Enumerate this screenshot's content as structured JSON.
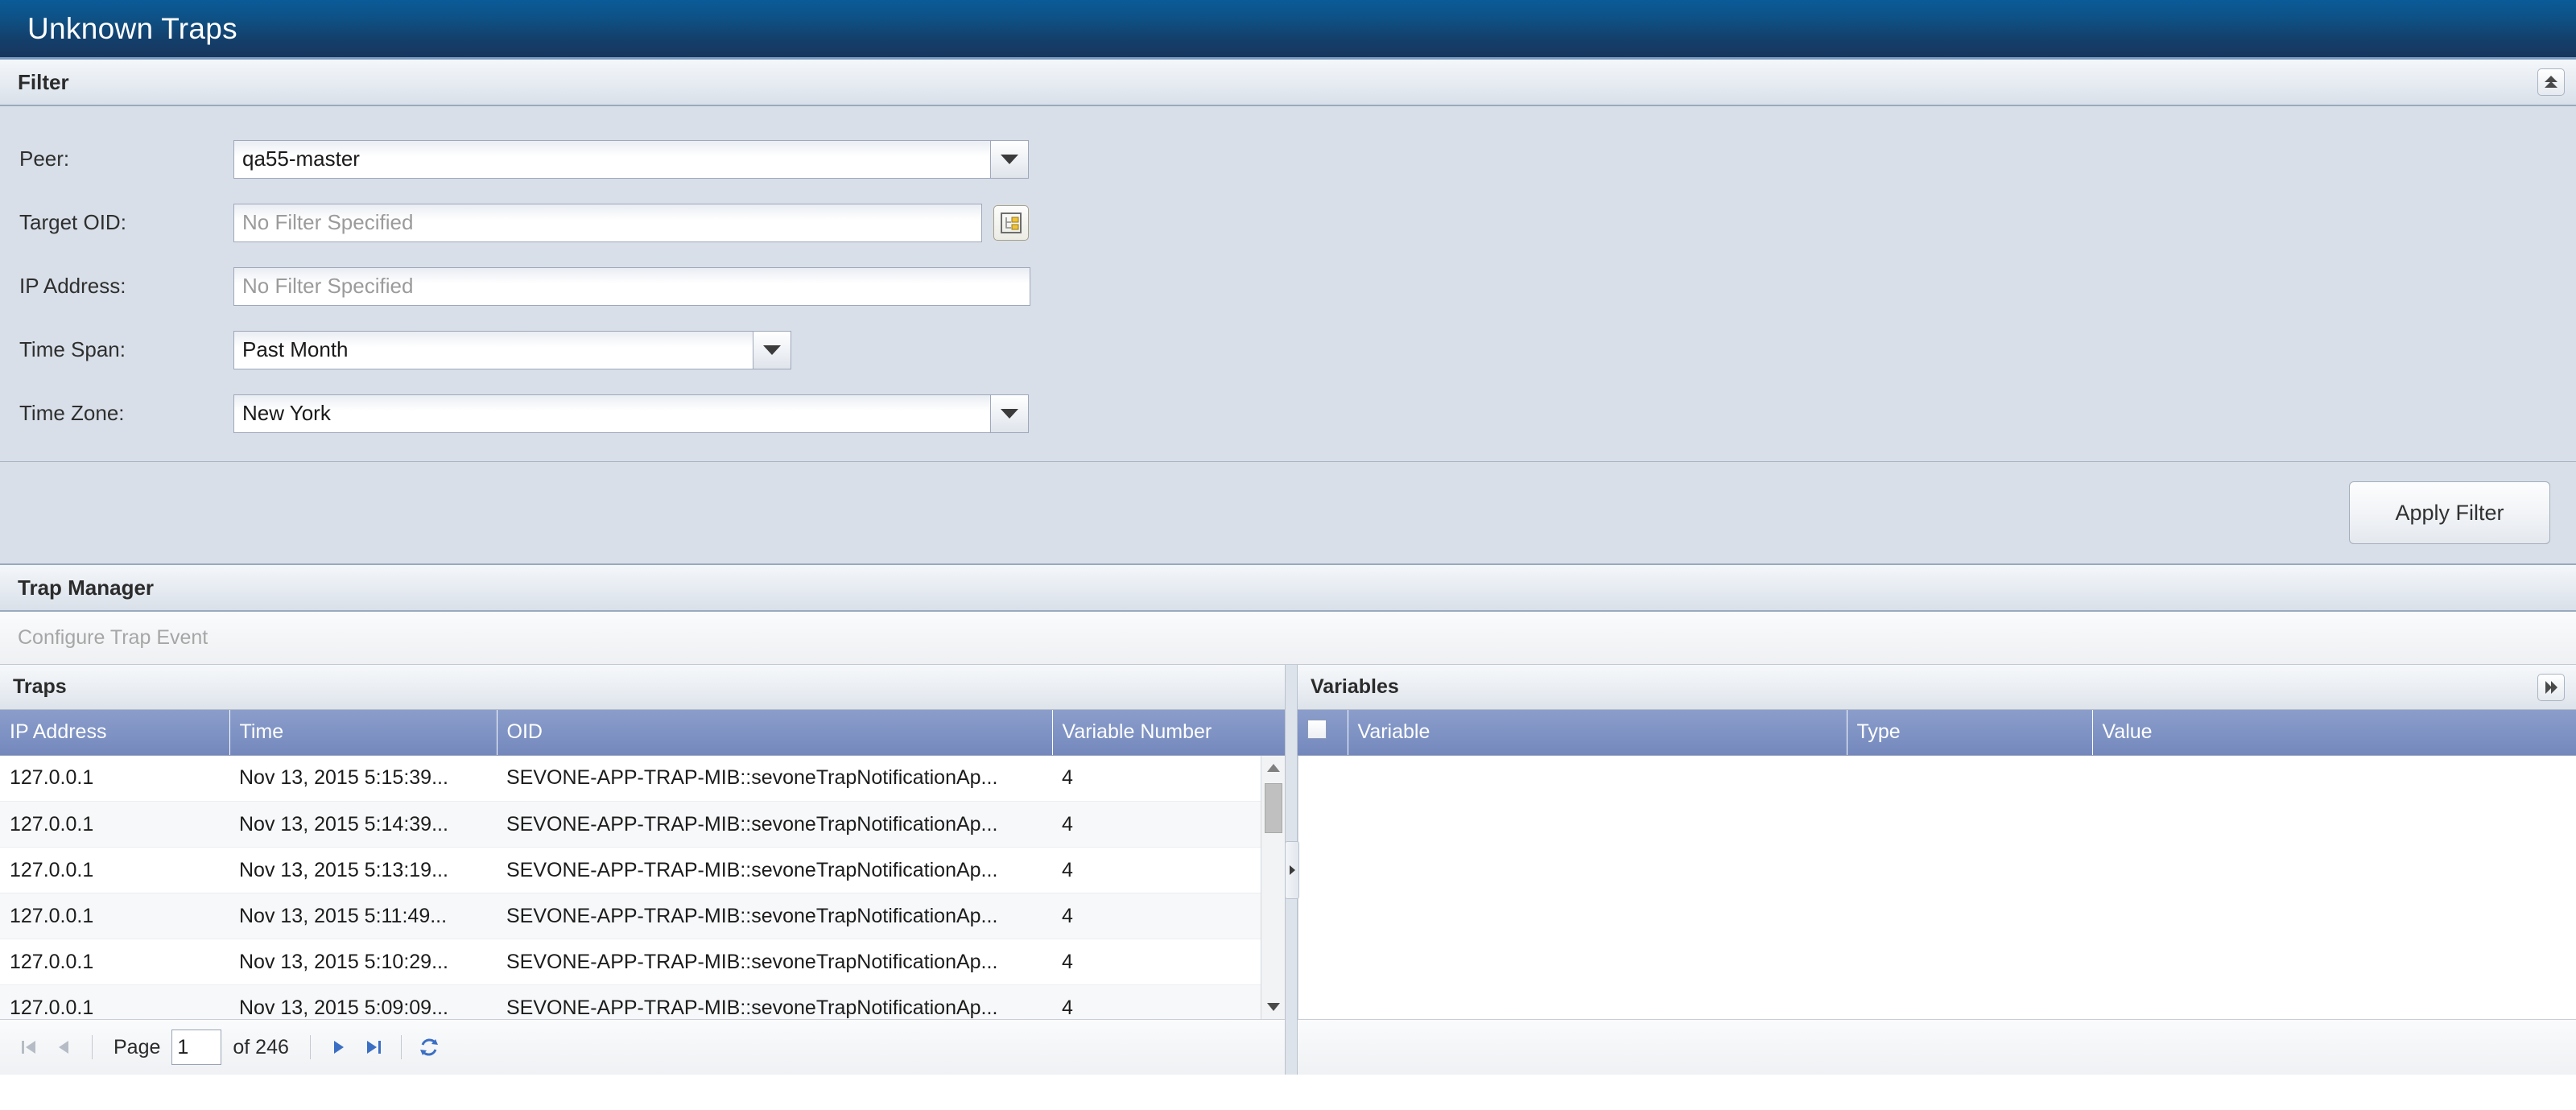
{
  "window": {
    "title": "Unknown Traps"
  },
  "filter": {
    "header": "Filter",
    "collapse_icon": "chevron-double-up-icon",
    "fields": {
      "peer": {
        "label": "Peer:",
        "value": "qa55-master",
        "type": "combobox"
      },
      "target_oid": {
        "label": "Target OID:",
        "value": "",
        "placeholder": "No Filter Specified",
        "browse_icon": "tree-folder-icon"
      },
      "ip_address": {
        "label": "IP Address:",
        "value": "",
        "placeholder": "No Filter Specified"
      },
      "time_span": {
        "label": "Time Span:",
        "value": "Past Month",
        "type": "combobox"
      },
      "time_zone": {
        "label": "Time Zone:",
        "value": "New York",
        "type": "combobox"
      }
    },
    "apply_button": "Apply Filter"
  },
  "trap_manager": {
    "header": "Trap Manager",
    "toolbar_item": "Configure Trap Event"
  },
  "traps": {
    "header": "Traps",
    "columns": [
      "IP Address",
      "Time",
      "OID",
      "Variable Number"
    ],
    "rows": [
      {
        "ip": "127.0.0.1",
        "time": "Nov 13, 2015 5:15:39...",
        "oid": "SEVONE-APP-TRAP-MIB::sevoneTrapNotificationAp...",
        "vars": "4"
      },
      {
        "ip": "127.0.0.1",
        "time": "Nov 13, 2015 5:14:39...",
        "oid": "SEVONE-APP-TRAP-MIB::sevoneTrapNotificationAp...",
        "vars": "4"
      },
      {
        "ip": "127.0.0.1",
        "time": "Nov 13, 2015 5:13:19...",
        "oid": "SEVONE-APP-TRAP-MIB::sevoneTrapNotificationAp...",
        "vars": "4"
      },
      {
        "ip": "127.0.0.1",
        "time": "Nov 13, 2015 5:11:49...",
        "oid": "SEVONE-APP-TRAP-MIB::sevoneTrapNotificationAp...",
        "vars": "4"
      },
      {
        "ip": "127.0.0.1",
        "time": "Nov 13, 2015 5:10:29...",
        "oid": "SEVONE-APP-TRAP-MIB::sevoneTrapNotificationAp...",
        "vars": "4"
      },
      {
        "ip": "127.0.0.1",
        "time": "Nov 13, 2015 5:09:09...",
        "oid": "SEVONE-APP-TRAP-MIB::sevoneTrapNotificationAp...",
        "vars": "4"
      }
    ]
  },
  "variables": {
    "header": "Variables",
    "expand_icon": "chevron-double-right-icon",
    "columns": [
      "",
      "Variable",
      "Type",
      "Value"
    ],
    "rows": []
  },
  "pager": {
    "first_icon": "first-page-icon",
    "prev_icon": "previous-page-icon",
    "page_label": "Page",
    "page_value": "1",
    "of_label": "of 246",
    "next_icon": "next-page-icon",
    "last_icon": "last-page-icon",
    "refresh_icon": "refresh-icon"
  },
  "colors": {
    "title_gradient_start": "#0a5b99",
    "title_gradient_end": "#17365d",
    "grid_header": "#7f93c4",
    "filter_body": "#d8dfe8",
    "pager_active": "#3b6fc4",
    "pager_disabled": "#b6bcc5"
  }
}
